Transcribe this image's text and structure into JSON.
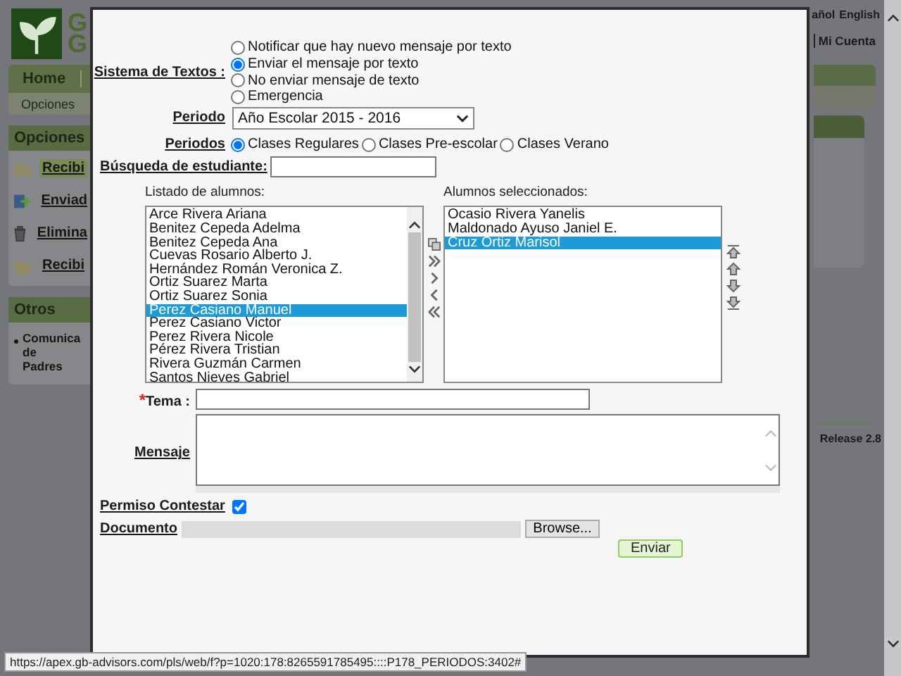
{
  "header": {
    "logo_letters": [
      "G",
      "G"
    ],
    "languages": [
      {
        "label": "añol"
      },
      {
        "label": "English"
      }
    ],
    "account": "Mi Cuenta"
  },
  "nav": {
    "tab": "Home",
    "subtab": "Opciones"
  },
  "sidebar": {
    "panels": [
      {
        "title": "Opciones",
        "items": [
          {
            "label": "Recibi",
            "kind": "folder",
            "selected": true
          },
          {
            "label": "Enviad",
            "kind": "send",
            "selected": false
          },
          {
            "label": "Elimina",
            "kind": "trash",
            "selected": false
          },
          {
            "label": "Recibi",
            "kind": "folder",
            "selected": false
          }
        ]
      },
      {
        "title": "Otros",
        "items": [
          {
            "label": "Comunica de Padres",
            "kind": "bullet",
            "selected": false
          }
        ]
      }
    ]
  },
  "footer": {
    "release": "Release 2.8"
  },
  "dialog": {
    "text_system": {
      "label": "Sistema de Textos :",
      "options": [
        {
          "label": "Notificar que hay nuevo mensaje por texto",
          "selected": false
        },
        {
          "label": "Enviar el mensaje por texto",
          "selected": true
        },
        {
          "label": "No enviar mensaje de texto",
          "selected": false
        },
        {
          "label": "Emergencia",
          "selected": false
        }
      ]
    },
    "period": {
      "label": "Periodo",
      "value": "Año Escolar 2015 - 2016"
    },
    "periods": {
      "label": "Periodos",
      "options": [
        {
          "label": "Clases Regulares",
          "selected": true
        },
        {
          "label": "Clases Pre-escolar",
          "selected": false
        },
        {
          "label": "Clases Verano",
          "selected": false
        }
      ]
    },
    "student_search": {
      "label": "Búsqueda de estudiante:"
    },
    "student_list": {
      "label": "Listado de alumnos:",
      "items": [
        {
          "name": "Arce Rivera Ariana",
          "selected": false
        },
        {
          "name": "Benitez Cepeda Adelma",
          "selected": false
        },
        {
          "name": "Benitez Cepeda Ana",
          "selected": false
        },
        {
          "name": "Cuevas Rosario Alberto J.",
          "selected": false
        },
        {
          "name": "Hernández Román Veronica Z.",
          "selected": false
        },
        {
          "name": "Ortiz Suarez Marta",
          "selected": false
        },
        {
          "name": "Ortiz Suarez Sonia",
          "selected": false
        },
        {
          "name": "Perez Casiano Manuel",
          "selected": true
        },
        {
          "name": "Perez Casiano Victor",
          "selected": false
        },
        {
          "name": "Perez Rivera Nicole",
          "selected": false
        },
        {
          "name": "Pérez Rivera Tristian",
          "selected": false
        },
        {
          "name": "Rivera Guzmán Carmen",
          "selected": false
        },
        {
          "name": "Santos Nieves Gabriel",
          "selected": false
        }
      ]
    },
    "selected_students": {
      "label": "Alumnos seleccionados:",
      "items": [
        {
          "name": "Ocasio Rivera Yanelis",
          "selected": false
        },
        {
          "name": "Maldonado Ayuso Janiel E.",
          "selected": false
        },
        {
          "name": "Cruz Ortiz Marisol",
          "selected": true
        }
      ]
    },
    "subject": {
      "required_mark": "*",
      "label": "Tema :"
    },
    "message": {
      "label": "Mensaje"
    },
    "reply_permission": {
      "label": "Permiso Contestar",
      "checked": true
    },
    "document": {
      "label": "Documento",
      "button": "Browse..."
    },
    "send_button": "Enviar"
  },
  "status_bar": {
    "url": "https://apex.gb-advisors.com/pls/web/f?p=1020:178:8265591785495::::P178_PERIODOS:3402#"
  }
}
